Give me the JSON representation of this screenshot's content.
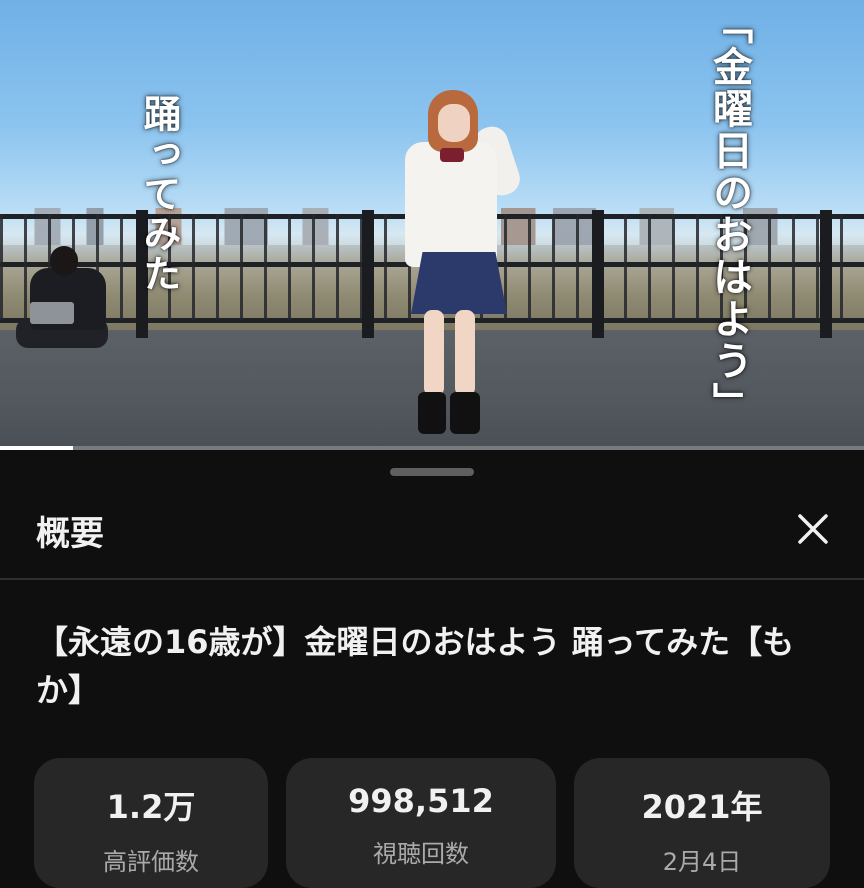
{
  "video": {
    "overlay_left_text": "踊ってみた",
    "overlay_right_text": "「金曜日のおはよう」",
    "progress_fraction": 0.085
  },
  "sheet": {
    "title": "概要",
    "close_icon": "close-icon",
    "video_title": "【永遠の16歳が】金曜日のおはよう 踊ってみた【もか】",
    "stats": [
      {
        "value": "1.2万",
        "label": "高評価数"
      },
      {
        "value": "998,512",
        "label": "視聴回数"
      },
      {
        "value": "2021年",
        "label": "2月4日"
      }
    ]
  },
  "colors": {
    "background": "#0f0f0f",
    "card": "#272727",
    "text_primary": "#f1f1f1",
    "text_secondary": "#aaaaaa"
  }
}
